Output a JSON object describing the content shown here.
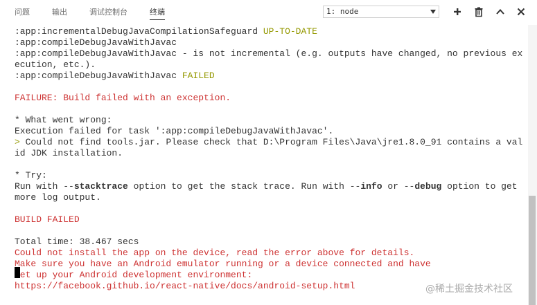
{
  "tabs": [
    {
      "label": "问题",
      "active": false
    },
    {
      "label": "输出",
      "active": false
    },
    {
      "label": "调试控制台",
      "active": false
    },
    {
      "label": "终端",
      "active": true
    }
  ],
  "terminal_select": {
    "value": "1: node"
  },
  "toolbar": {
    "icons": [
      "plus-icon",
      "trash-icon",
      "chevron-up-icon",
      "close-icon"
    ]
  },
  "colors": {
    "default_text": "#333333",
    "yellow": "#949800",
    "red": "#cd3131",
    "cursor": "#000000"
  },
  "terminal": {
    "lines": [
      [
        {
          "text": ":app:incrementalDebugJavaCompilationSafeguard ",
          "color": "default"
        },
        {
          "text": "UP-TO-DATE",
          "color": "yellow"
        }
      ],
      [
        {
          "text": ":app:compileDebugJavaWithJavac",
          "color": "default"
        }
      ],
      [
        {
          "text": ":app:compileDebugJavaWithJavac - is not incremental (e.g. outputs have changed, no previous ex",
          "color": "default"
        }
      ],
      [
        {
          "text": "ecution, etc.).",
          "color": "default"
        }
      ],
      [
        {
          "text": ":app:compileDebugJavaWithJavac ",
          "color": "default"
        },
        {
          "text": "FAILED",
          "color": "yellow"
        }
      ],
      [
        {
          "text": "",
          "color": "default"
        }
      ],
      [
        {
          "text": "FAILURE: Build failed with an exception.",
          "color": "red"
        }
      ],
      [
        {
          "text": "",
          "color": "default"
        }
      ],
      [
        {
          "text": "* What went wrong:",
          "color": "default"
        }
      ],
      [
        {
          "text": "Execution failed for task ':app:compileDebugJavaWithJavac'.",
          "color": "default"
        }
      ],
      [
        {
          "text": "> ",
          "color": "yellow"
        },
        {
          "text": "Could not find tools.jar. Please check that D:\\Program Files\\Java\\jre1.8.0_91 contains a val",
          "color": "default"
        }
      ],
      [
        {
          "text": "id JDK installation.",
          "color": "default"
        }
      ],
      [
        {
          "text": "",
          "color": "default"
        }
      ],
      [
        {
          "text": "* Try:",
          "color": "default"
        }
      ],
      [
        {
          "text": "Run with --",
          "color": "default"
        },
        {
          "text": "stacktrace",
          "color": "bold"
        },
        {
          "text": " option to get the stack trace. Run with --",
          "color": "default"
        },
        {
          "text": "info",
          "color": "bold"
        },
        {
          "text": " or --",
          "color": "default"
        },
        {
          "text": "debug",
          "color": "bold"
        },
        {
          "text": " option to get",
          "color": "default"
        }
      ],
      [
        {
          "text": "more log output.",
          "color": "default"
        }
      ],
      [
        {
          "text": "",
          "color": "default"
        }
      ],
      [
        {
          "text": "BUILD FAILED",
          "color": "red"
        }
      ],
      [
        {
          "text": "",
          "color": "default"
        }
      ],
      [
        {
          "text": "Total time: 38.467 secs",
          "color": "default"
        }
      ],
      [
        {
          "text": "Could not install the app on the device, read the error above for details.",
          "color": "red"
        }
      ],
      [
        {
          "text": "Make sure you have an Android emulator running or a device connected and have",
          "color": "red"
        }
      ],
      [
        {
          "text": "set up your Android development environment:",
          "color": "red"
        }
      ],
      [
        {
          "text": "https://facebook.github.io/react-native/docs/android-setup.html",
          "color": "red"
        }
      ]
    ]
  },
  "watermark": "@稀土掘金技术社区"
}
